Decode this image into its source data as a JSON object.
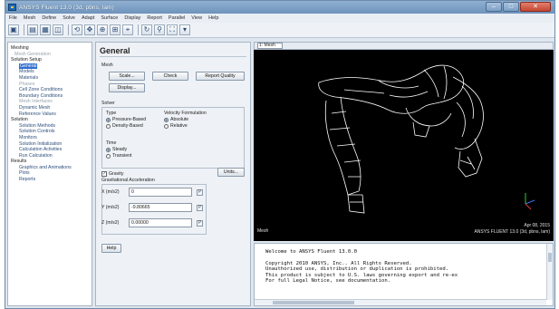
{
  "window": {
    "title": "ANSYS Fluent 13.0 (3d, pbns, lam)",
    "controls": {
      "minimize": "–",
      "maximize": "□",
      "close": "✕"
    }
  },
  "menubar": [
    "File",
    "Mesh",
    "Define",
    "Solve",
    "Adapt",
    "Surface",
    "Display",
    "Report",
    "Parallel",
    "View",
    "Help"
  ],
  "toolbar": {
    "icons": [
      "open-file-icon",
      "save-icon",
      "write-icon",
      "print-icon",
      "rotate-icon",
      "translate-icon",
      "zoom-icon",
      "zoom-to-fit-icon",
      "probe-icon",
      "mouse-rotate-icon",
      "mouse-zoom-icon",
      "fit-view-icon",
      "view-dropdown-icon"
    ],
    "glyphs": [
      "▣",
      "▤",
      "▦",
      "◫",
      "⟲",
      "✥",
      "⊕",
      "⊞",
      "⌖",
      "↻",
      "⚲",
      "⛶",
      "▾"
    ]
  },
  "tree": {
    "meshing": "Meshing",
    "mesh_generation": "Mesh Generation",
    "solution_setup": "Solution Setup",
    "setup_items": [
      "General",
      "Models",
      "Materials",
      "Phases",
      "Cell Zone Conditions",
      "Boundary Conditions",
      "Mesh Interfaces",
      "Dynamic Mesh",
      "Reference Values"
    ],
    "solution": "Solution",
    "solution_items": [
      "Solution Methods",
      "Solution Controls",
      "Monitors",
      "Solution Initialization",
      "Calculation Activities",
      "Run Calculation"
    ],
    "results": "Results",
    "results_items": [
      "Graphics and Animations",
      "Plots",
      "Reports"
    ]
  },
  "general_panel": {
    "title": "General",
    "mesh_label": "Mesh",
    "scale_button": "Scale...",
    "check_button": "Check",
    "report_quality_button": "Report Quality",
    "display_button": "Display...",
    "solver_label": "Solver",
    "type_label": "Type",
    "type_pressure": "Pressure-Based",
    "type_density": "Density-Based",
    "velocity_label": "Velocity Formulation",
    "velocity_absolute": "Absolute",
    "velocity_relative": "Relative",
    "time_label": "Time",
    "time_steady": "Steady",
    "time_transient": "Transient",
    "gravity_label": "Gravity",
    "units_button": "Units...",
    "grav_accel_label": "Gravitational Acceleration",
    "x_label": "X (m/s2)",
    "x_value": "0",
    "y_label": "Y (m/s2)",
    "y_value": "-9.80665",
    "z_label": "Z (m/s2)",
    "z_value": "0.00000",
    "help_button": "Help"
  },
  "graphics": {
    "window_select": "1: Mesh",
    "caption_left": "Mesh",
    "caption_date": "Apr 08, 2015",
    "caption_product": "ANSYS FLUENT 13.0 (3d, pbns, lam)"
  },
  "console": {
    "lines": [
      "Welcome to ANSYS Fluent 13.0.0",
      "",
      "Copyright 2010 ANSYS, Inc.. All Rights Reserved.",
      "Unauthorized use, distribution or duplication is prohibited.",
      "This product is subject to U.S. laws governing export and re-ex",
      "For full Legal Notice, see documentation."
    ]
  },
  "colors": {
    "titlebar": "#7b9dc4",
    "selection": "#2f6fd0",
    "graphics_bg": "#000000",
    "mesh_lines": "#ffffff"
  }
}
